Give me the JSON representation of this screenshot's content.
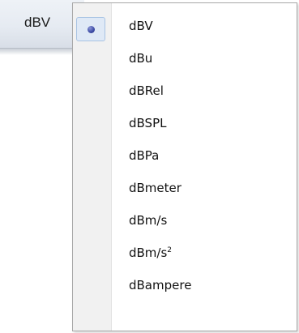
{
  "unit_button": {
    "label": "dBV"
  },
  "menu": {
    "selected_index": 0,
    "items": [
      {
        "label": "dBV",
        "selected": true
      },
      {
        "label": "dBu",
        "selected": false
      },
      {
        "label": "dBRel",
        "selected": false
      },
      {
        "label": "dBSPL",
        "selected": false
      },
      {
        "label": "dBPa",
        "selected": false
      },
      {
        "label": "dBmeter",
        "selected": false
      },
      {
        "label": "dBm/s",
        "selected": false
      },
      {
        "label": "dBm/s",
        "sup": "2",
        "selected": false
      },
      {
        "label": "dBampere",
        "selected": false
      }
    ]
  },
  "colors": {
    "selection_fill": "#dfe9f6",
    "selection_border": "#a8c3e3",
    "radio_dot": "#3b4aa5",
    "gutter": "#f1f1f1"
  }
}
